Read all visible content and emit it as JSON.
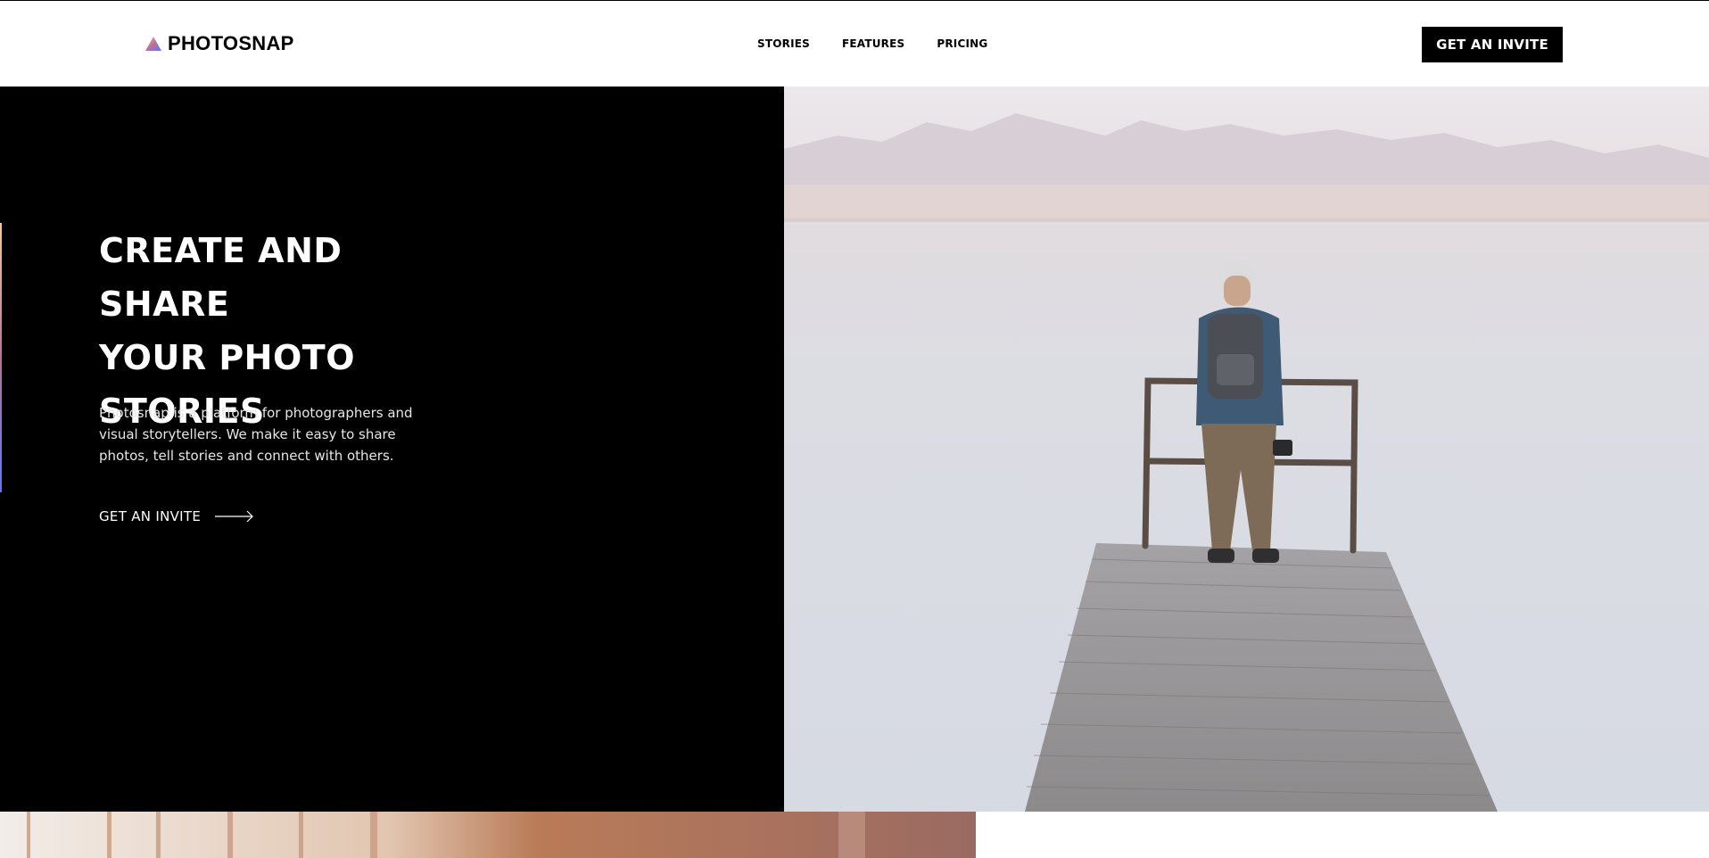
{
  "brand": {
    "name": "PHOTOSNAP",
    "logo_icon": "triangle-gradient-logo",
    "gradient": [
      "#ffc593",
      "#bc7198",
      "#5a77ff"
    ]
  },
  "nav": {
    "items": [
      {
        "label": "STORIES"
      },
      {
        "label": "FEATURES"
      },
      {
        "label": "PRICING"
      }
    ]
  },
  "header": {
    "cta_label": "GET AN INVITE"
  },
  "hero": {
    "title_lines": [
      "CREATE AND SHARE",
      "YOUR PHOTO",
      "STORIES"
    ],
    "description": "Photosnap is a platform for photographers and visual storytellers. We make it easy to share photos, tell stories and connect with others.",
    "link_label": "GET AN INVITE",
    "link_icon": "arrow-right-icon",
    "background": "#000000",
    "text_color": "#ffffff"
  },
  "colors": {
    "black": "#000000",
    "white": "#ffffff"
  }
}
